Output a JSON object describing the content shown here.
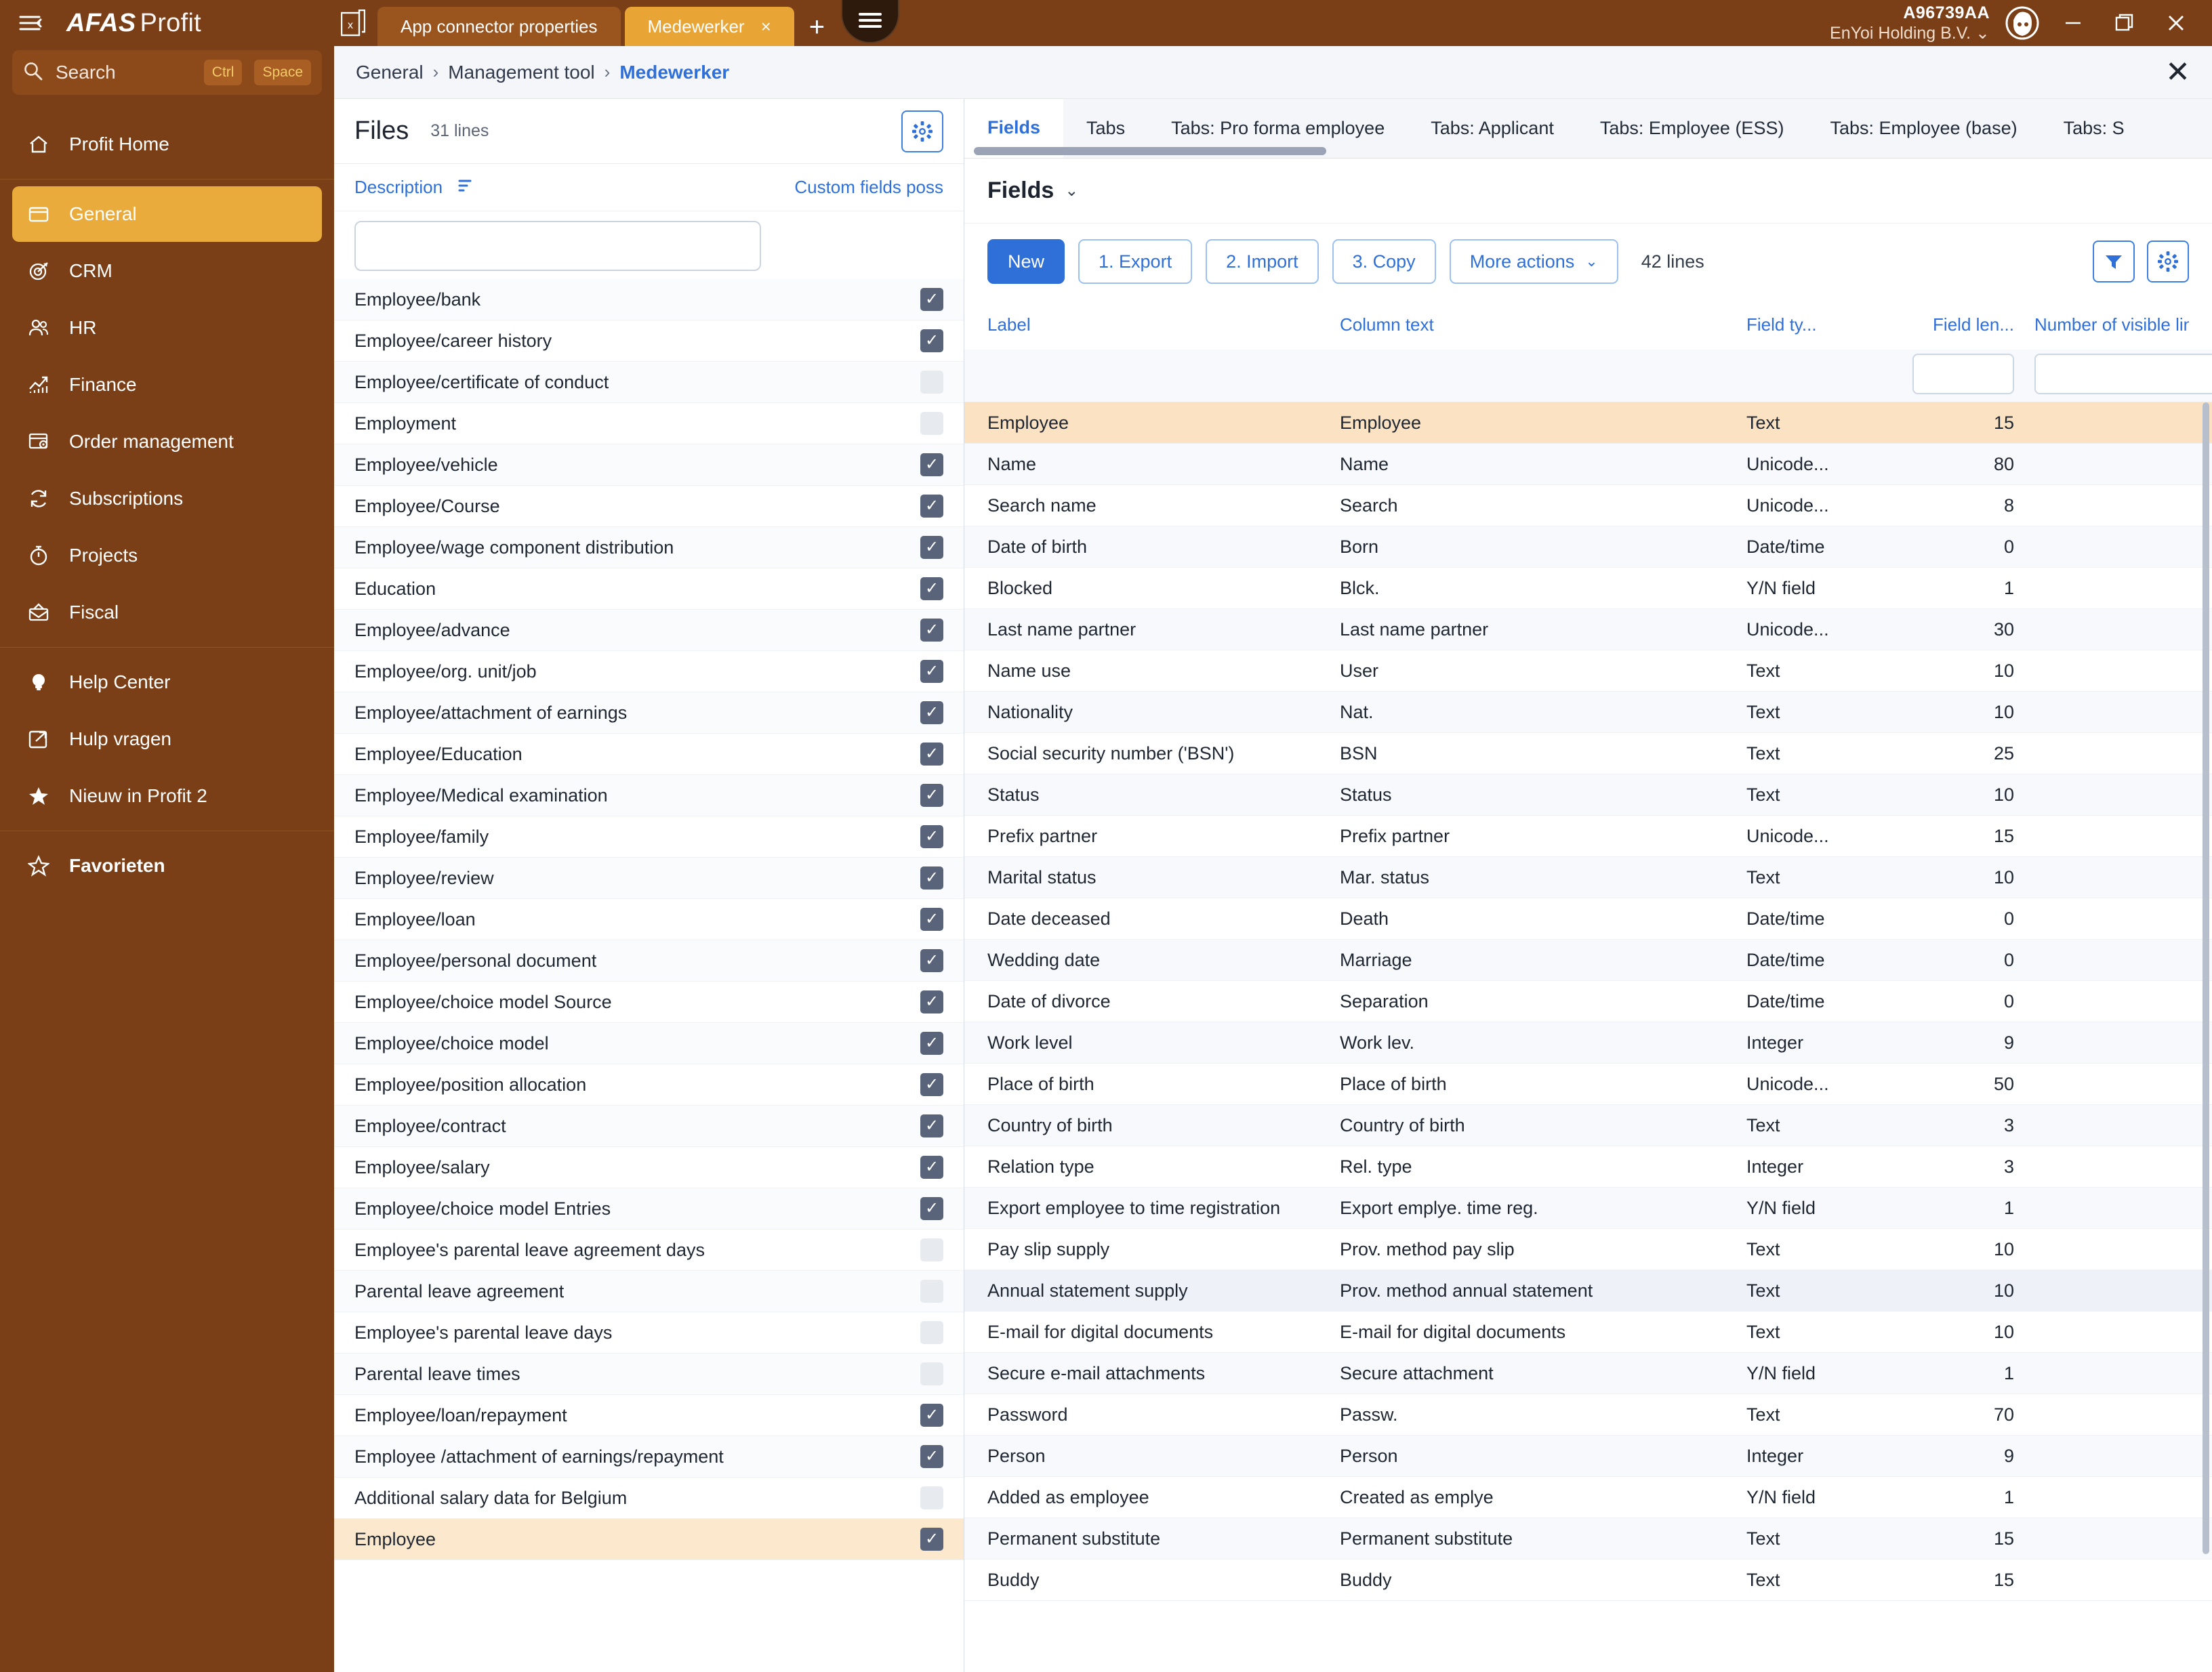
{
  "titlebar": {
    "hamburger_icon": "menu-collapse-icon",
    "brand_bold": "AFAS",
    "brand_light": "Profit",
    "doc_icon": "excel-document-icon",
    "tabs": [
      {
        "label": "App connector properties",
        "active": false,
        "closable": false
      },
      {
        "label": "Medewerker",
        "active": true,
        "closable": true,
        "close_label": "×"
      }
    ],
    "new_tab_label": "+",
    "menu_pill_icon": "hamburger-menu-icon",
    "account_id": "A96739AA",
    "account_company": "EnYoi Holding B.V.",
    "account_chevron": "⌄",
    "avatar_icon": "user-avatar-icon",
    "minimize_label": "—",
    "maximize_label": "❐",
    "close_label": "✕"
  },
  "sidebar": {
    "search": {
      "label": "Search",
      "kbd1": "Ctrl",
      "kbd2": "Space",
      "icon": "search-icon"
    },
    "groups": [
      {
        "items": [
          {
            "label": "Profit Home",
            "icon": "home-icon",
            "active": false
          }
        ]
      },
      {
        "items": [
          {
            "label": "General",
            "icon": "window-icon",
            "active": true
          },
          {
            "label": "CRM",
            "icon": "target-icon",
            "active": false
          },
          {
            "label": "HR",
            "icon": "people-icon",
            "active": false
          },
          {
            "label": "Finance",
            "icon": "chart-up-icon",
            "active": false
          },
          {
            "label": "Order management",
            "icon": "order-icon",
            "active": false
          },
          {
            "label": "Subscriptions",
            "icon": "refresh-icon",
            "active": false
          },
          {
            "label": "Projects",
            "icon": "stopwatch-icon",
            "active": false
          },
          {
            "label": "Fiscal",
            "icon": "envelope-icon",
            "active": false
          }
        ]
      },
      {
        "items": [
          {
            "label": "Help Center",
            "icon": "lightbulb-icon",
            "active": false
          },
          {
            "label": "Hulp vragen",
            "icon": "external-link-icon",
            "active": false
          },
          {
            "label": "Nieuw in Profit 2",
            "icon": "star-filled-icon",
            "active": false
          }
        ]
      },
      {
        "items": [
          {
            "label": "Favorieten",
            "icon": "star-outline-icon",
            "active": false,
            "bold": true
          }
        ]
      }
    ]
  },
  "breadcrumb": {
    "items": [
      "General",
      "Management tool",
      "Medewerker"
    ],
    "separator": "›",
    "close_label": "✕"
  },
  "files_panel": {
    "title": "Files",
    "count_label": "31 lines",
    "settings_icon": "gear-icon",
    "col_description": "Description",
    "col_sort_icon": "sort-icon",
    "col_custom_fields": "Custom fields poss",
    "filter_placeholder": "",
    "filter_value": "",
    "rows": [
      {
        "name": "Employee/bank",
        "checked": true,
        "selected": false
      },
      {
        "name": "Employee/career history",
        "checked": true,
        "selected": false
      },
      {
        "name": "Employee/certificate of conduct",
        "checked": false,
        "selected": false
      },
      {
        "name": "Employment",
        "checked": false,
        "selected": false
      },
      {
        "name": "Employee/vehicle",
        "checked": true,
        "selected": false
      },
      {
        "name": "Employee/Course",
        "checked": true,
        "selected": false
      },
      {
        "name": "Employee/wage component distribution",
        "checked": true,
        "selected": false
      },
      {
        "name": "Education",
        "checked": true,
        "selected": false
      },
      {
        "name": "Employee/advance",
        "checked": true,
        "selected": false
      },
      {
        "name": "Employee/org. unit/job",
        "checked": true,
        "selected": false
      },
      {
        "name": "Employee/attachment of earnings",
        "checked": true,
        "selected": false
      },
      {
        "name": "Employee/Education",
        "checked": true,
        "selected": false
      },
      {
        "name": "Employee/Medical examination",
        "checked": true,
        "selected": false
      },
      {
        "name": "Employee/family",
        "checked": true,
        "selected": false
      },
      {
        "name": "Employee/review",
        "checked": true,
        "selected": false
      },
      {
        "name": "Employee/loan",
        "checked": true,
        "selected": false
      },
      {
        "name": "Employee/personal document",
        "checked": true,
        "selected": false
      },
      {
        "name": "Employee/choice model Source",
        "checked": true,
        "selected": false
      },
      {
        "name": "Employee/choice model",
        "checked": true,
        "selected": false
      },
      {
        "name": "Employee/position allocation",
        "checked": true,
        "selected": false
      },
      {
        "name": "Employee/contract",
        "checked": true,
        "selected": false
      },
      {
        "name": "Employee/salary",
        "checked": true,
        "selected": false
      },
      {
        "name": "Employee/choice model Entries",
        "checked": true,
        "selected": false
      },
      {
        "name": "Employee's parental leave agreement days",
        "checked": false,
        "selected": false
      },
      {
        "name": "Parental leave agreement",
        "checked": false,
        "selected": false
      },
      {
        "name": "Employee's parental leave days",
        "checked": false,
        "selected": false
      },
      {
        "name": "Parental leave times",
        "checked": false,
        "selected": false
      },
      {
        "name": "Employee/loan/repayment",
        "checked": true,
        "selected": false
      },
      {
        "name": "Employee /attachment of earnings/repayment",
        "checked": true,
        "selected": false
      },
      {
        "name": "Additional salary data for Belgium",
        "checked": false,
        "selected": false
      },
      {
        "name": "Employee",
        "checked": true,
        "selected": true
      }
    ]
  },
  "fields_panel": {
    "tabs": [
      {
        "label": "Fields",
        "active": true
      },
      {
        "label": "Tabs",
        "active": false
      },
      {
        "label": "Tabs: Pro forma employee",
        "active": false
      },
      {
        "label": "Tabs: Applicant",
        "active": false
      },
      {
        "label": "Tabs: Employee (ESS)",
        "active": false
      },
      {
        "label": "Tabs: Employee (base)",
        "active": false
      },
      {
        "label": "Tabs: S",
        "active": false
      }
    ],
    "subtitle": "Fields",
    "subtitle_chevron": "⌄",
    "toolbar": {
      "new_label": "New",
      "export_label": "1. Export",
      "import_label": "2. Import",
      "copy_label": "3. Copy",
      "more_actions_label": "More actions",
      "more_actions_chevron": "⌄",
      "lines_label": "42 lines",
      "filter_icon": "filter-icon",
      "settings_icon": "gear-icon"
    },
    "columns": [
      "Label",
      "Column text",
      "Field ty...",
      "Field len...",
      "Number of visible line"
    ],
    "rows": [
      {
        "label": "Employee",
        "column_text": "Employee",
        "field_type": "Text",
        "field_length": "15",
        "selected": true
      },
      {
        "label": "Name",
        "column_text": "Name",
        "field_type": "Unicode...",
        "field_length": "80"
      },
      {
        "label": "Search name",
        "column_text": "Search",
        "field_type": "Unicode...",
        "field_length": "8"
      },
      {
        "label": "Date of birth",
        "column_text": "Born",
        "field_type": "Date/time",
        "field_length": "0"
      },
      {
        "label": "Blocked",
        "column_text": "Blck.",
        "field_type": "Y/N field",
        "field_length": "1"
      },
      {
        "label": "Last name partner",
        "column_text": "Last name partner",
        "field_type": "Unicode...",
        "field_length": "30"
      },
      {
        "label": "Name use",
        "column_text": "User",
        "field_type": "Text",
        "field_length": "10"
      },
      {
        "label": "Nationality",
        "column_text": "Nat.",
        "field_type": "Text",
        "field_length": "10"
      },
      {
        "label": "Social security number ('BSN')",
        "column_text": "BSN",
        "field_type": "Text",
        "field_length": "25"
      },
      {
        "label": "Status",
        "column_text": "Status",
        "field_type": "Text",
        "field_length": "10"
      },
      {
        "label": "Prefix partner",
        "column_text": "Prefix partner",
        "field_type": "Unicode...",
        "field_length": "15"
      },
      {
        "label": "Marital status",
        "column_text": "Mar. status",
        "field_type": "Text",
        "field_length": "10"
      },
      {
        "label": "Date deceased",
        "column_text": "Death",
        "field_type": "Date/time",
        "field_length": "0"
      },
      {
        "label": "Wedding date",
        "column_text": "Marriage",
        "field_type": "Date/time",
        "field_length": "0"
      },
      {
        "label": "Date of divorce",
        "column_text": "Separation",
        "field_type": "Date/time",
        "field_length": "0"
      },
      {
        "label": "Work level",
        "column_text": "Work lev.",
        "field_type": "Integer",
        "field_length": "9"
      },
      {
        "label": "Place of birth",
        "column_text": "Place of birth",
        "field_type": "Unicode...",
        "field_length": "50"
      },
      {
        "label": "Country of birth",
        "column_text": "Country of birth",
        "field_type": "Text",
        "field_length": "3"
      },
      {
        "label": "Relation type",
        "column_text": "Rel. type",
        "field_type": "Integer",
        "field_length": "3"
      },
      {
        "label": "Export employee to time registration",
        "column_text": "Export emplye. time reg.",
        "field_type": "Y/N field",
        "field_length": "1"
      },
      {
        "label": "Pay slip supply",
        "column_text": "Prov. method pay slip",
        "field_type": "Text",
        "field_length": "10"
      },
      {
        "label": "Annual statement supply",
        "column_text": "Prov. method annual statement",
        "field_type": "Text",
        "field_length": "10",
        "highlight": true
      },
      {
        "label": "E-mail for digital documents",
        "column_text": "E-mail for digital documents",
        "field_type": "Text",
        "field_length": "10"
      },
      {
        "label": "Secure e-mail attachments",
        "column_text": "Secure attachment",
        "field_type": "Y/N field",
        "field_length": "1"
      },
      {
        "label": "Password",
        "column_text": "Passw.",
        "field_type": "Text",
        "field_length": "70"
      },
      {
        "label": "Person",
        "column_text": "Person",
        "field_type": "Integer",
        "field_length": "9"
      },
      {
        "label": "Added as employee",
        "column_text": "Created as emplye",
        "field_type": "Y/N field",
        "field_length": "1"
      },
      {
        "label": "Permanent substitute",
        "column_text": "Permanent substitute",
        "field_type": "Text",
        "field_length": "15"
      },
      {
        "label": "Buddy",
        "column_text": "Buddy",
        "field_type": "Text",
        "field_length": "15"
      }
    ]
  },
  "colors": {
    "brand_brown": "#7a3f17",
    "accent_amber": "#e8a434",
    "link_blue": "#2e6fd9",
    "selected_row": "#fbe2c3"
  }
}
